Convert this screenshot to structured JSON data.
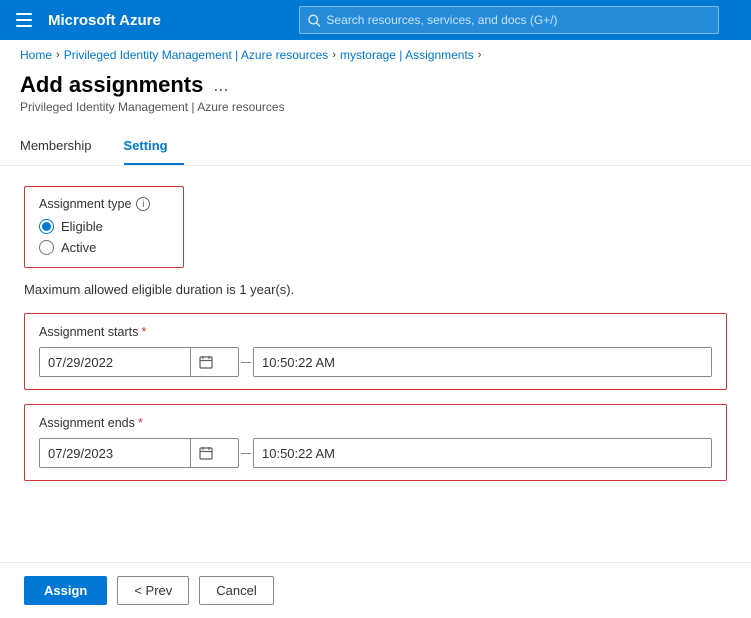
{
  "topbar": {
    "logo": "Microsoft Azure",
    "search_placeholder": "Search resources, services, and docs (G+/)"
  },
  "breadcrumb": {
    "items": [
      {
        "label": "Home",
        "link": true
      },
      {
        "label": "Privileged Identity Management | Azure resources",
        "link": true
      },
      {
        "label": "mystorage | Assignments",
        "link": true
      }
    ]
  },
  "page": {
    "title": "Add assignments",
    "subtitle": "Privileged Identity Management | Azure resources",
    "dots_label": "..."
  },
  "tabs": [
    {
      "label": "Membership",
      "active": false
    },
    {
      "label": "Setting",
      "active": true
    }
  ],
  "assignment_type": {
    "label": "Assignment type",
    "info_icon": "i",
    "options": [
      {
        "label": "Eligible",
        "checked": true,
        "value": "eligible"
      },
      {
        "label": "Active",
        "checked": false,
        "value": "active"
      }
    ]
  },
  "info_text": "Maximum allowed eligible duration is 1 year(s).",
  "assignment_starts": {
    "label": "Assignment starts",
    "required": true,
    "date_value": "07/29/2022",
    "time_value": "10:50:22 AM",
    "calendar_icon": "📅"
  },
  "assignment_ends": {
    "label": "Assignment ends",
    "required": true,
    "date_value": "07/29/2023",
    "time_value": "10:50:22 AM",
    "calendar_icon": "📅"
  },
  "footer": {
    "assign_label": "Assign",
    "prev_label": "< Prev",
    "cancel_label": "Cancel"
  }
}
